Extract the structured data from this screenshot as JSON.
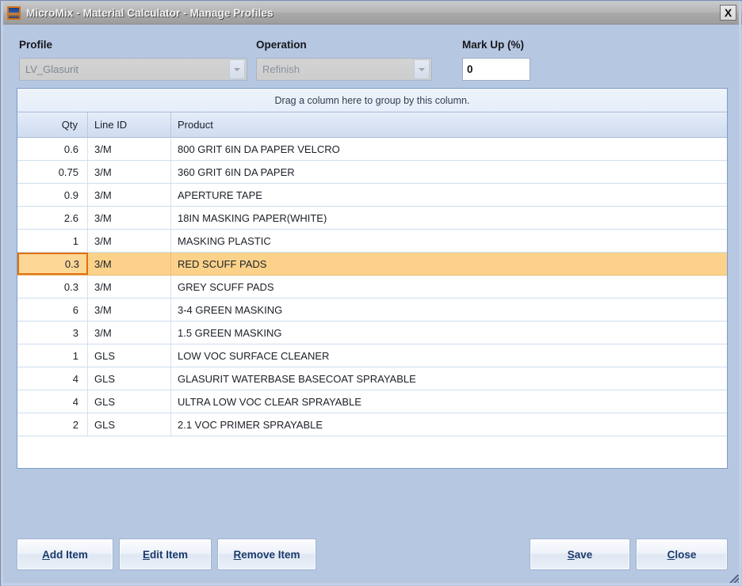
{
  "window": {
    "title": "MicroMix - Material Calculator - Manage Profiles",
    "app_icon": "micromix-app-icon",
    "close_label": "X",
    "accent_color": "#e2700d",
    "titlebar_color": "#b0b0b0",
    "body_color": "#b6c7e2"
  },
  "form": {
    "profile": {
      "label": "Profile",
      "value": "LV_Glasurit",
      "disabled": true
    },
    "operation": {
      "label": "Operation",
      "value": "Refinish",
      "disabled": true
    },
    "markup": {
      "label": "Mark Up (%)",
      "value": "0",
      "placeholder": ""
    }
  },
  "grid": {
    "group_panel_text": "Drag a column here to group by this column.",
    "columns": [
      "Qty",
      "Line ID",
      "Product"
    ],
    "selected_row_index": 5,
    "rows": [
      {
        "qty": "0.6",
        "line_id": "3/M",
        "product": "800 GRIT 6IN DA PAPER VELCRO"
      },
      {
        "qty": "0.75",
        "line_id": "3/M",
        "product": "360 GRIT 6IN DA PAPER"
      },
      {
        "qty": "0.9",
        "line_id": "3/M",
        "product": "APERTURE TAPE"
      },
      {
        "qty": "2.6",
        "line_id": "3/M",
        "product": "18IN MASKING PAPER(WHITE)"
      },
      {
        "qty": "1",
        "line_id": "3/M",
        "product": "MASKING PLASTIC"
      },
      {
        "qty": "0.3",
        "line_id": "3/M",
        "product": "RED SCUFF PADS"
      },
      {
        "qty": "0.3",
        "line_id": "3/M",
        "product": "GREY SCUFF PADS"
      },
      {
        "qty": "6",
        "line_id": "3/M",
        "product": "3-4 GREEN MASKING"
      },
      {
        "qty": "3",
        "line_id": "3/M",
        "product": "1.5 GREEN MASKING"
      },
      {
        "qty": "1",
        "line_id": "GLS",
        "product": "LOW VOC SURFACE CLEANER"
      },
      {
        "qty": "4",
        "line_id": "GLS",
        "product": "GLASURIT WATERBASE BASECOAT SPRAYABLE"
      },
      {
        "qty": "4",
        "line_id": "GLS",
        "product": "ULTRA LOW VOC CLEAR SPRAYABLE"
      },
      {
        "qty": "2",
        "line_id": "GLS",
        "product": "2.1 VOC PRIMER SPRAYABLE"
      }
    ]
  },
  "footer": {
    "add_item": {
      "accel": "A",
      "rest": "dd Item"
    },
    "edit_item": {
      "accel": "E",
      "rest": "dit Item"
    },
    "remove_item": {
      "accel": "R",
      "rest": "emove Item"
    },
    "save": {
      "accel": "S",
      "rest": "ave"
    },
    "close": {
      "accel": "C",
      "rest": "lose"
    }
  }
}
